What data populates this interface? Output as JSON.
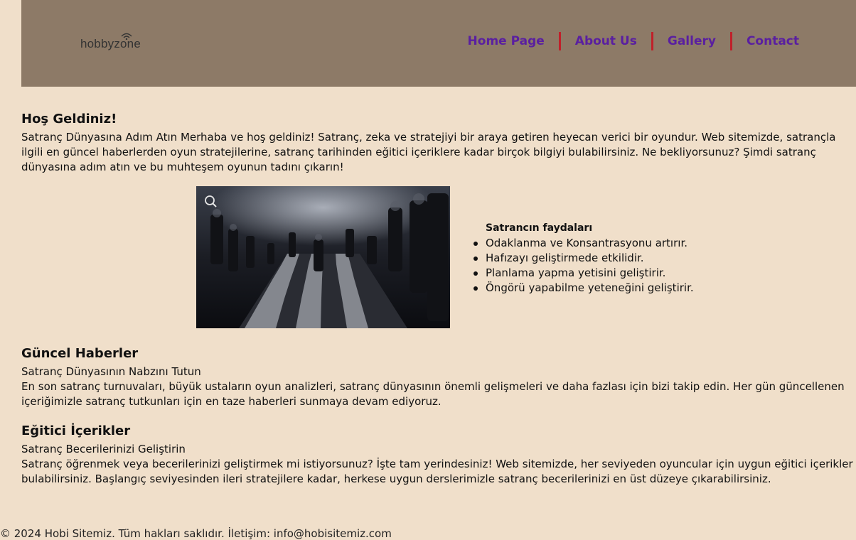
{
  "header": {
    "logo_text": "hobbyzone",
    "nav": [
      "Home Page",
      "About Us",
      "Gallery",
      "Contact"
    ]
  },
  "welcome": {
    "title": "Hoş Geldiniz!",
    "text": "Satranç Dünyasına Adım Atın Merhaba ve hoş geldiniz! Satranç, zeka ve stratejiyi bir araya getiren heyecan verici bir oyundur. Web sitemizde, satrançla ilgili en güncel haberlerden oyun stratejilerine, satranç tarihinden eğitici içeriklere kadar birçok bilgiyi bulabilirsiniz. Ne bekliyorsunuz? Şimdi satranç dünyasına adım atın ve bu muhteşem oyunun tadını çıkarın!"
  },
  "benefits": {
    "title": "Satrancın faydaları",
    "items": [
      "Odaklanma ve Konsantrasyonu artırır.",
      "Hafızayı geliştirmede etkilidir.",
      "Planlama yapma yetisini geliştirir.",
      "Öngörü yapabilme yeteneğini geliştirir."
    ]
  },
  "news": {
    "title": "Güncel Haberler",
    "subtitle": "Satranç Dünyasının Nabzını Tutun",
    "text": "En son satranç turnuvaları, büyük ustaların oyun analizleri, satranç dünyasının önemli gelişmeleri ve daha fazlası için bizi takip edin. Her gün güncellenen içeriğimizle satranç tutkunları için en taze haberleri sunmaya devam ediyoruz."
  },
  "education": {
    "title": "Eğitici İçerikler",
    "subtitle": "Satranç Becerilerinizi Geliştirin",
    "text": "Satranç öğrenmek veya becerilerinizi geliştirmek mi istiyorsunuz? İşte tam yerindesiniz! Web sitemizde, her seviyeden oyuncular için uygun eğitici içerikler bulabilirsiniz. Başlangıç seviyesinden ileri stratejilere kadar, herkese uygun derslerimizle satranç becerilerinizi en üst düzeye çıkarabilirsiniz."
  },
  "footer": {
    "text": "© 2024 Hobi Sitemiz. Tüm hakları saklıdır. İletişim: info@hobisitemiz.com"
  },
  "colors": {
    "background": "#f0dfca",
    "header": "#8d7a67",
    "nav_link": "#5a1fa0",
    "nav_separator": "#c0202a"
  }
}
